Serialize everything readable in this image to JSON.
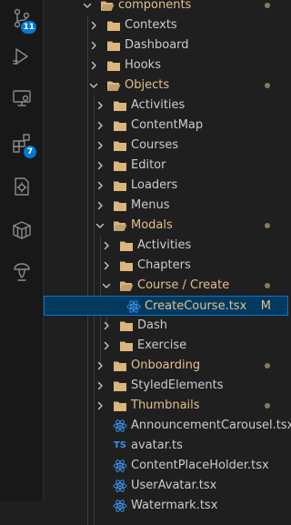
{
  "activity_bar": [
    {
      "name": "source-control-icon",
      "badge": "11"
    },
    {
      "name": "run-debug-icon",
      "badge": ""
    },
    {
      "name": "remote-explorer-icon",
      "badge": ""
    },
    {
      "name": "extensions-icon",
      "badge": "7"
    },
    {
      "name": "testing-icon",
      "badge": ""
    },
    {
      "name": "containers-icon",
      "badge": ""
    },
    {
      "name": "accounts-hat-icon",
      "badge": ""
    }
  ],
  "colors": {
    "folder": "#dcb67a",
    "modified_text": "#e2c08d",
    "react_icon": "#3b8eea",
    "selection": "#04395e",
    "focus_border": "#0078d4"
  },
  "tree": [
    {
      "label": "components",
      "depth": 0,
      "kind": "folder",
      "expanded": true,
      "modified": true,
      "git": "dot",
      "icon": "folder-components-icon"
    },
    {
      "label": "Contexts",
      "depth": 1,
      "kind": "folder",
      "expanded": false,
      "modified": false,
      "git": "",
      "icon": "folder-icon"
    },
    {
      "label": "Dashboard",
      "depth": 1,
      "kind": "folder",
      "expanded": false,
      "modified": false,
      "git": "",
      "icon": "folder-icon"
    },
    {
      "label": "Hooks",
      "depth": 1,
      "kind": "folder",
      "expanded": false,
      "modified": false,
      "git": "",
      "icon": "folder-hooks-icon"
    },
    {
      "label": "Objects",
      "depth": 1,
      "kind": "folder",
      "expanded": true,
      "modified": true,
      "git": "dot",
      "icon": "folder-open-icon"
    },
    {
      "label": "Activities",
      "depth": 2,
      "kind": "folder",
      "expanded": false,
      "modified": false,
      "git": "",
      "icon": "folder-icon"
    },
    {
      "label": "ContentMap",
      "depth": 2,
      "kind": "folder",
      "expanded": false,
      "modified": false,
      "git": "",
      "icon": "folder-icon"
    },
    {
      "label": "Courses",
      "depth": 2,
      "kind": "folder",
      "expanded": false,
      "modified": false,
      "git": "",
      "icon": "folder-icon"
    },
    {
      "label": "Editor",
      "depth": 2,
      "kind": "folder",
      "expanded": false,
      "modified": false,
      "git": "",
      "icon": "folder-icon"
    },
    {
      "label": "Loaders",
      "depth": 2,
      "kind": "folder",
      "expanded": false,
      "modified": false,
      "git": "",
      "icon": "folder-icon"
    },
    {
      "label": "Menus",
      "depth": 2,
      "kind": "folder",
      "expanded": false,
      "modified": false,
      "git": "",
      "icon": "folder-icon"
    },
    {
      "label": "Modals",
      "depth": 2,
      "kind": "folder",
      "expanded": true,
      "modified": true,
      "git": "dot",
      "icon": "folder-open-icon"
    },
    {
      "label": "Activities",
      "depth": 3,
      "kind": "folder",
      "expanded": false,
      "modified": false,
      "git": "",
      "icon": "folder-icon"
    },
    {
      "label": "Chapters",
      "depth": 3,
      "kind": "folder",
      "expanded": false,
      "modified": false,
      "git": "",
      "icon": "folder-icon"
    },
    {
      "label": "Course / Create",
      "depth": 3,
      "kind": "folder",
      "expanded": true,
      "modified": true,
      "git": "dot",
      "icon": "folder-open-icon"
    },
    {
      "label": "CreateCourse.tsx",
      "depth": 4,
      "kind": "file",
      "filetype": "react",
      "modified": true,
      "git": "M",
      "selected": true,
      "icon": "react-icon"
    },
    {
      "label": "Dash",
      "depth": 3,
      "kind": "folder",
      "expanded": false,
      "modified": false,
      "git": "",
      "icon": "folder-icon"
    },
    {
      "label": "Exercise",
      "depth": 3,
      "kind": "folder",
      "expanded": false,
      "modified": false,
      "git": "",
      "icon": "folder-icon"
    },
    {
      "label": "Onboarding",
      "depth": 2,
      "kind": "folder",
      "expanded": false,
      "modified": true,
      "git": "dot",
      "icon": "folder-icon"
    },
    {
      "label": "StyledElements",
      "depth": 2,
      "kind": "folder",
      "expanded": false,
      "modified": false,
      "git": "",
      "icon": "folder-icon"
    },
    {
      "label": "Thumbnails",
      "depth": 2,
      "kind": "folder",
      "expanded": false,
      "modified": true,
      "git": "dot",
      "icon": "folder-icon"
    },
    {
      "label": "AnnouncementCarousel.tsx",
      "depth": 2,
      "kind": "file",
      "filetype": "react",
      "modified": false,
      "git": "",
      "icon": "react-icon"
    },
    {
      "label": "avatar.ts",
      "depth": 2,
      "kind": "file",
      "filetype": "ts",
      "icon_text": "TS",
      "modified": false,
      "git": "",
      "icon": "typescript-icon"
    },
    {
      "label": "ContentPlaceHolder.tsx",
      "depth": 2,
      "kind": "file",
      "filetype": "react",
      "modified": false,
      "git": "",
      "icon": "react-icon"
    },
    {
      "label": "UserAvatar.tsx",
      "depth": 2,
      "kind": "file",
      "filetype": "react",
      "modified": false,
      "git": "",
      "icon": "react-icon"
    },
    {
      "label": "Watermark.tsx",
      "depth": 2,
      "kind": "file",
      "filetype": "react",
      "modified": false,
      "git": "",
      "icon": "react-icon"
    }
  ]
}
